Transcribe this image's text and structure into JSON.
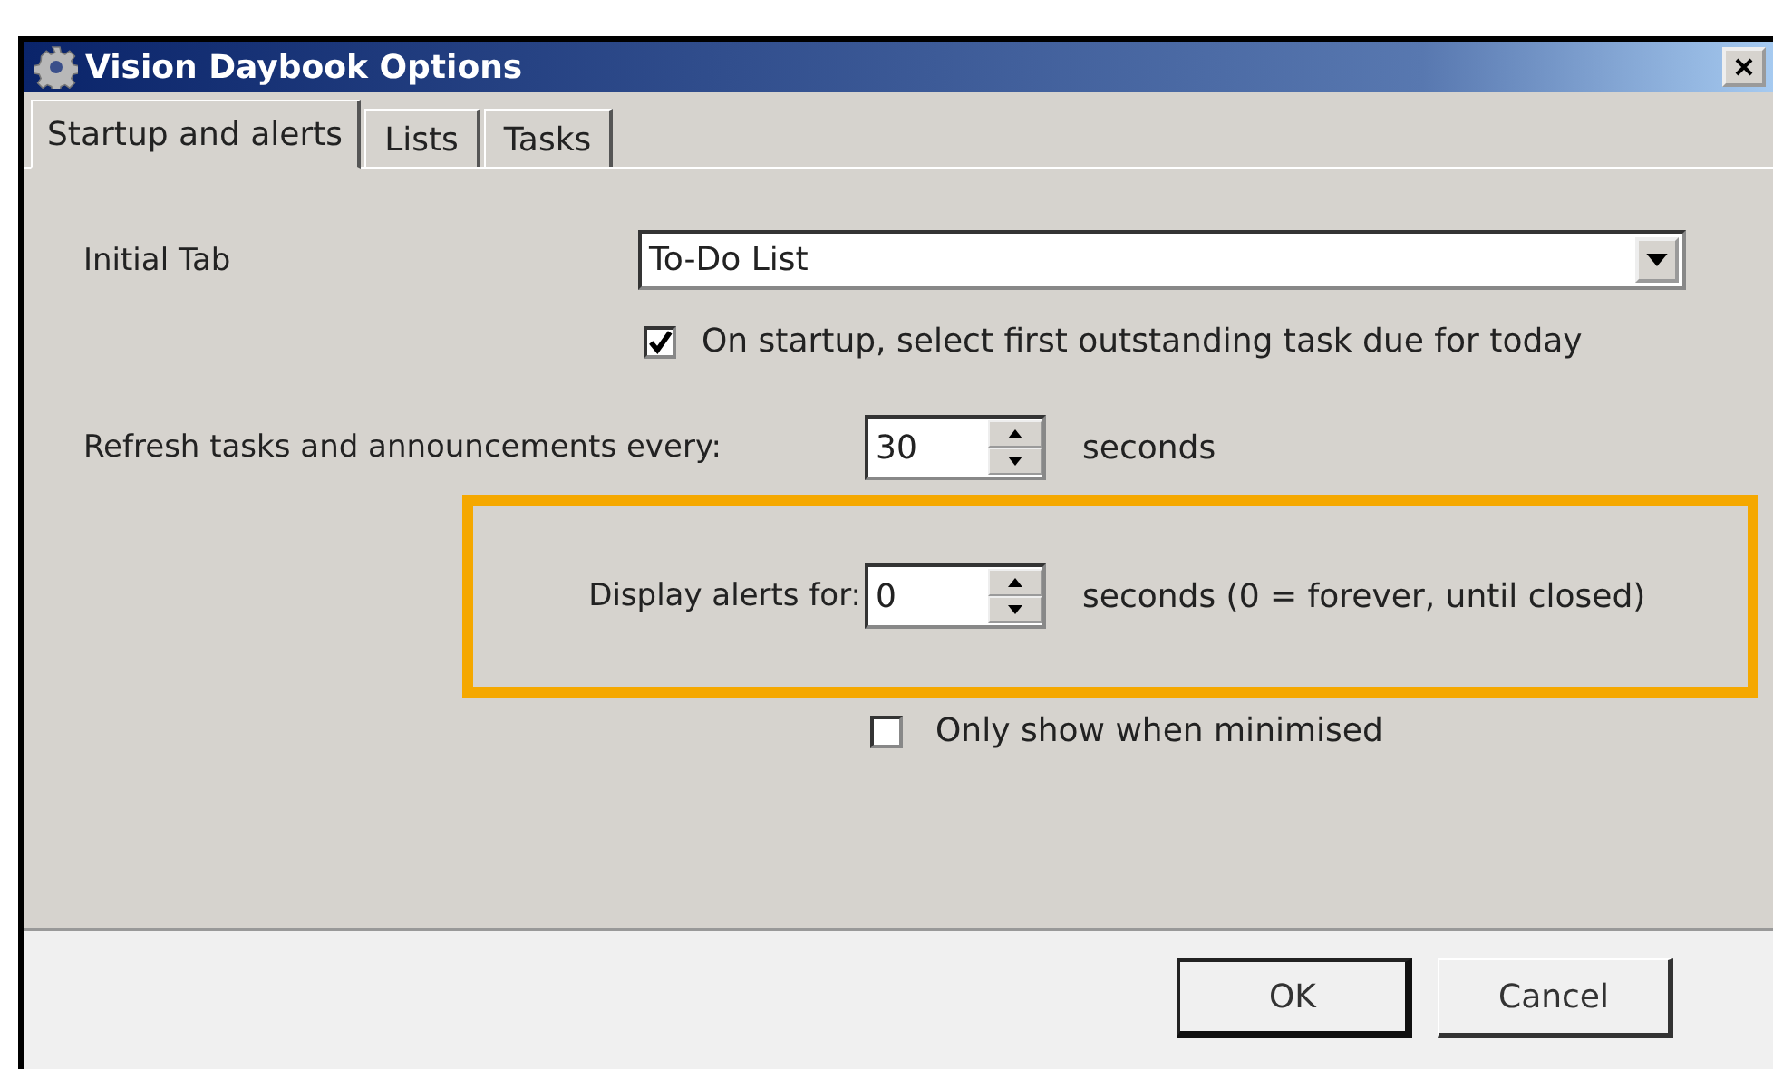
{
  "window": {
    "title": "Vision Daybook Options"
  },
  "tabs": [
    {
      "label": "Startup and alerts",
      "selected": true
    },
    {
      "label": "Lists",
      "selected": false
    },
    {
      "label": "Tasks",
      "selected": false
    }
  ],
  "initial_tab": {
    "label": "Initial Tab",
    "value": "To-Do List"
  },
  "select_first_task": {
    "label": "On startup, select first outstanding task due for today",
    "checked": true
  },
  "refresh": {
    "label": "Refresh tasks and announcements every:",
    "value": "30",
    "unit": "seconds"
  },
  "display_alerts": {
    "label": "Display alerts for:",
    "value": "0",
    "unit": "seconds (0 = forever, until closed)",
    "highlighted": true
  },
  "only_minimised": {
    "label": "Only show when minimised",
    "checked": false
  },
  "buttons": [
    {
      "label": "OK",
      "default": true
    },
    {
      "label": "Cancel",
      "default": false
    }
  ]
}
